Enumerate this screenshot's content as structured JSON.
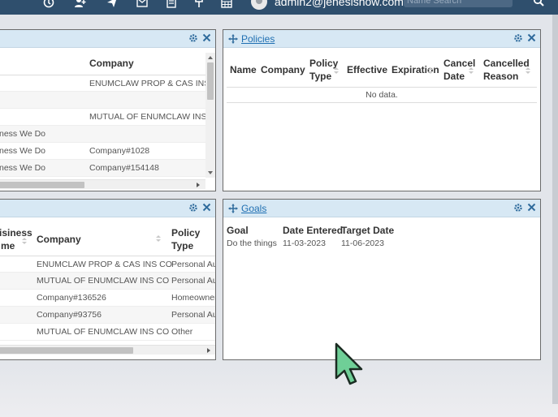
{
  "topbar": {
    "username": "admin2@jenesishow.com",
    "search_placeholder": "Name Search",
    "icons": [
      "clock-icon",
      "user-add-icon",
      "send-icon",
      "mail-icon",
      "document-icon",
      "fork-icon",
      "calendar-icon",
      "avatar",
      "search-icon"
    ]
  },
  "panel_top_left": {
    "header": "Company",
    "rows": [
      {
        "business": "",
        "company": "ENUMCLAW PROP & CAS INS"
      },
      {
        "business": "",
        "company": ""
      },
      {
        "business": "",
        "company": "MUTUAL OF ENUMCLAW INS"
      },
      {
        "business": "ness We Do",
        "company": ""
      },
      {
        "business": "ness We Do",
        "company": "Company#1028"
      },
      {
        "business": "ness We Do",
        "company": "Company#154148"
      }
    ]
  },
  "panel_policies": {
    "title": "Policies",
    "columns": {
      "name": "Name",
      "company": "Company",
      "policy_type_1": "Policy",
      "policy_type_2": "Type",
      "effective": "Effective",
      "expiration": "Expiration",
      "cancel_date_1": "Cancel",
      "cancel_date_2": "Date",
      "cancelled_reason_1": "Cancelled",
      "cancelled_reason_2": "Reason"
    },
    "empty_text": "No data."
  },
  "panel_bottom_left": {
    "columns": {
      "business_1": "isiness",
      "business_2": "me",
      "company": "Company",
      "policy_type_1": "Policy",
      "policy_type_2": "Type"
    },
    "rows": [
      {
        "company": "ENUMCLAW PROP & CAS INS CO",
        "policy_type": "Personal Au"
      },
      {
        "company": "MUTUAL OF ENUMCLAW INS CO",
        "policy_type": "Personal Au"
      },
      {
        "company": "Company#136526",
        "policy_type": "Homeowner"
      },
      {
        "company": "Company#93756",
        "policy_type": "Personal Au"
      },
      {
        "company": "MUTUAL OF ENUMCLAW INS CO",
        "policy_type": "Other"
      }
    ]
  },
  "panel_goals": {
    "title": "Goals",
    "columns": {
      "goal": "Goal",
      "date_entered": "Date Entered",
      "target_date": "Target Date"
    },
    "rows": [
      {
        "goal": "Do the things",
        "date_entered": "11-03-2023",
        "target_date": "11-06-2023"
      }
    ]
  },
  "colors": {
    "topbar": "#2f4f6d",
    "panel_header": "#d7e8f4",
    "link": "#1f6fb2",
    "cursor_fill": "#6fcf97"
  }
}
